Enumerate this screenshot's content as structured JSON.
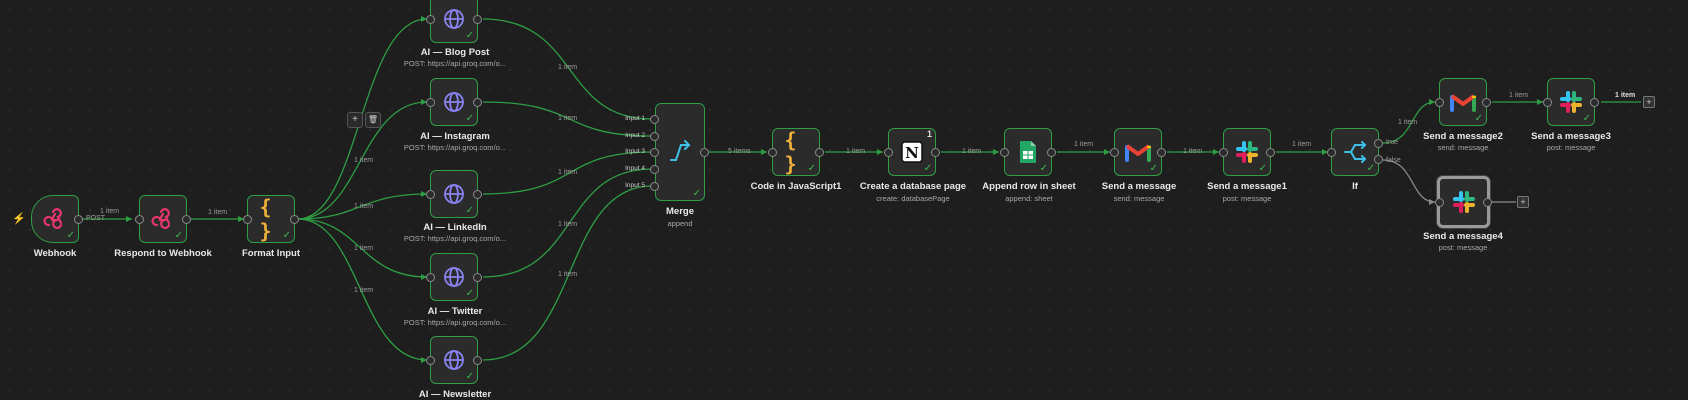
{
  "nodes": {
    "webhook": {
      "title": "Webhook",
      "icon": "webhook-icon"
    },
    "respond": {
      "title": "Respond to Webhook",
      "icon": "webhook-icon"
    },
    "format": {
      "title": "Format Input",
      "icon": "code-braces-icon"
    },
    "blog": {
      "title": "AI — Blog Post",
      "subtitle": "POST: https://api.groq.com/o...",
      "icon": "globe-icon"
    },
    "instagram": {
      "title": "AI — Instagram",
      "subtitle": "POST: https://api.groq.com/o...",
      "icon": "globe-icon"
    },
    "linkedin": {
      "title": "AI — LinkedIn",
      "subtitle": "POST: https://api.groq.com/o...",
      "icon": "globe-icon"
    },
    "twitter": {
      "title": "AI — Twitter",
      "subtitle": "POST: https://api.groq.com/o...",
      "icon": "globe-icon"
    },
    "newsletter": {
      "title": "AI — Newsletter",
      "icon": "globe-icon"
    },
    "merge": {
      "title": "Merge",
      "subtitle": "append",
      "icon": "merge-icon",
      "inputs": [
        "Input 1",
        "Input 2",
        "Input 3",
        "Input 4",
        "Input 5"
      ]
    },
    "code": {
      "title": "Code in JavaScript1",
      "icon": "code-braces-icon"
    },
    "notion": {
      "title": "Create a database page",
      "subtitle": "create: databasePage",
      "icon": "notion-icon",
      "badge": "1"
    },
    "sheets": {
      "title": "Append row in sheet",
      "subtitle": "append: sheet",
      "icon": "google-sheets-icon"
    },
    "gmail1": {
      "title": "Send a message",
      "subtitle": "send: message",
      "icon": "gmail-icon"
    },
    "slack1": {
      "title": "Send a message1",
      "subtitle": "post: message",
      "icon": "slack-icon"
    },
    "if": {
      "title": "If",
      "icon": "if-branch-icon",
      "true_label": "true",
      "false_label": "false"
    },
    "gmail2": {
      "title": "Send a message2",
      "subtitle": "send: message",
      "icon": "gmail-icon"
    },
    "slack3": {
      "title": "Send a message3",
      "subtitle": "post: message",
      "icon": "slack-icon"
    },
    "slack4": {
      "title": "Send a message4",
      "subtitle": "post: message",
      "icon": "slack-icon"
    }
  },
  "edges": {
    "post": "POST",
    "one_item": "1 item",
    "five_items": "5 items"
  },
  "toolbar": {
    "add": "+",
    "delete": "🗑"
  },
  "colors": {
    "canvas": "#1e1e1e",
    "node_success_border": "#2f9e44",
    "wire": "#2f9e44",
    "wire_inactive": "#8a8a8a",
    "webhook": "#e8366e",
    "code": "#f0b13b",
    "globe": "#8a83f2"
  }
}
